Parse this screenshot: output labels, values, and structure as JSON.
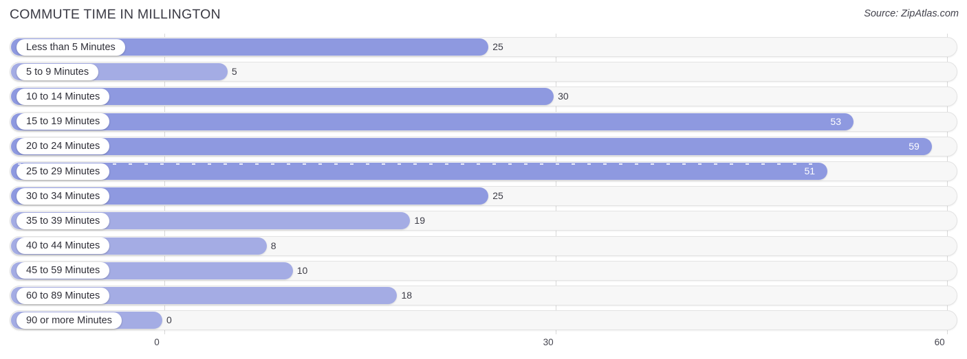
{
  "header": {
    "title": "COMMUTE TIME IN MILLINGTON",
    "source": "Source: ZipAtlas.com"
  },
  "chart_data": {
    "type": "bar",
    "orientation": "horizontal",
    "title": "COMMUTE TIME IN MILLINGTON",
    "xlabel": "",
    "ylabel": "",
    "xlim": [
      0,
      60
    ],
    "xticks": [
      0,
      30,
      60
    ],
    "xtick_labels": [
      "0",
      "30",
      "60"
    ],
    "grid": true,
    "legend": null,
    "bar_color": "#8e99e0",
    "bar_color_light": "#a4ace4",
    "track_color": "#f7f7f7",
    "categories": [
      "Less than 5 Minutes",
      "5 to 9 Minutes",
      "10 to 14 Minutes",
      "15 to 19 Minutes",
      "20 to 24 Minutes",
      "25 to 29 Minutes",
      "30 to 34 Minutes",
      "35 to 39 Minutes",
      "40 to 44 Minutes",
      "45 to 59 Minutes",
      "60 to 89 Minutes",
      "90 or more Minutes"
    ],
    "values": [
      25,
      5,
      30,
      53,
      59,
      51,
      25,
      19,
      8,
      10,
      18,
      0
    ],
    "value_labels": [
      "25",
      "5",
      "30",
      "53",
      "59",
      "51",
      "25",
      "19",
      "8",
      "10",
      "18",
      "0"
    ],
    "label_placement": [
      "outside",
      "outside",
      "outside",
      "inside",
      "inside",
      "inside",
      "outside",
      "outside",
      "outside",
      "outside",
      "outside",
      "outside"
    ],
    "highlighted_index": 5
  }
}
